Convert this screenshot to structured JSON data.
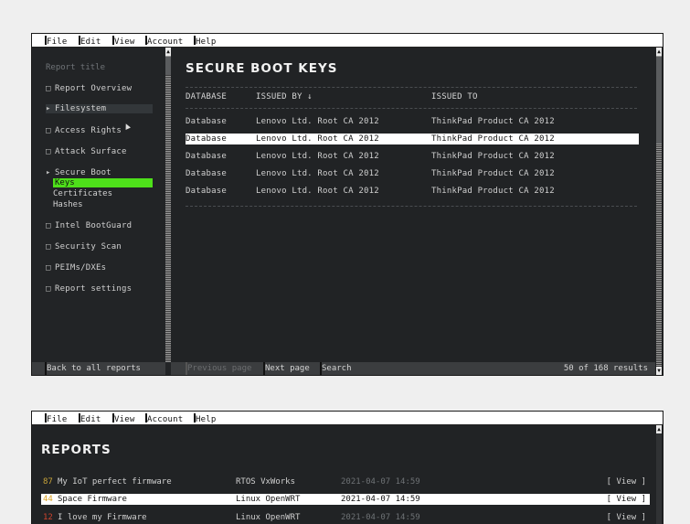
{
  "window1": {
    "menu": [
      "File",
      "Edit",
      "View",
      "Account",
      "Help"
    ],
    "sidebar": {
      "title": "Report title",
      "items": [
        {
          "marker": "□",
          "label": "Report Overview"
        },
        {
          "marker": "▸",
          "label": "Filesystem"
        },
        {
          "marker": "□",
          "label": "Access Rights"
        },
        {
          "marker": "□",
          "label": "Attack Surface"
        },
        {
          "marker": "▸",
          "label": "Secure Boot"
        },
        {
          "marker": "□",
          "label": "Intel BootGuard"
        },
        {
          "marker": "□",
          "label": "Security Scan"
        },
        {
          "marker": "□",
          "label": "PEIMs/DXEs"
        },
        {
          "marker": "□",
          "label": "Report settings"
        }
      ],
      "subitems": [
        "Keys",
        "Certificates",
        "Hashes"
      ]
    },
    "main": {
      "title": "SECURE BOOT KEYS",
      "columns": [
        "DATABASE",
        "ISSUED BY ↓",
        "ISSUED TO"
      ],
      "rows": [
        [
          "Database",
          "Lenovo Ltd. Root CA 2012",
          "ThinkPad Product CA 2012"
        ],
        [
          "Database",
          "Lenovo Ltd. Root CA 2012",
          "ThinkPad Product CA 2012"
        ],
        [
          "Database",
          "Lenovo Ltd. Root CA 2012",
          "ThinkPad Product CA 2012"
        ],
        [
          "Database",
          "Lenovo Ltd. Root CA 2012",
          "ThinkPad Product CA 2012"
        ],
        [
          "Database",
          "Lenovo Ltd. Root CA 2012",
          "ThinkPad Product CA 2012"
        ]
      ]
    },
    "bottombar": {
      "back": "Back to all reports",
      "prev": "Previous page",
      "next": "Next page",
      "search": "Search",
      "results": "50 of 168 results"
    }
  },
  "window2": {
    "menu": [
      "File",
      "Edit",
      "View",
      "Account",
      "Help"
    ],
    "title": "REPORTS",
    "reports": [
      {
        "score": "87",
        "name": "My IoT perfect firmware",
        "os": "RTOS VxWorks",
        "date": "2021-04-07 14:59",
        "action": "[ View ]"
      },
      {
        "score": "44",
        "name": "Space Firmware",
        "os": "Linux OpenWRT",
        "date": "2021-04-07 14:59",
        "action": "[ View ]"
      },
      {
        "score": "12",
        "name": "I love my Firmware",
        "os": "Linux OpenWRT",
        "date": "2021-04-07 14:59",
        "action": "[ View ]"
      }
    ]
  },
  "colors": {
    "accent_green": "#4ee01a",
    "background": "#212325",
    "score_yellow": "#c8a43a",
    "score_red": "#d0442e"
  }
}
